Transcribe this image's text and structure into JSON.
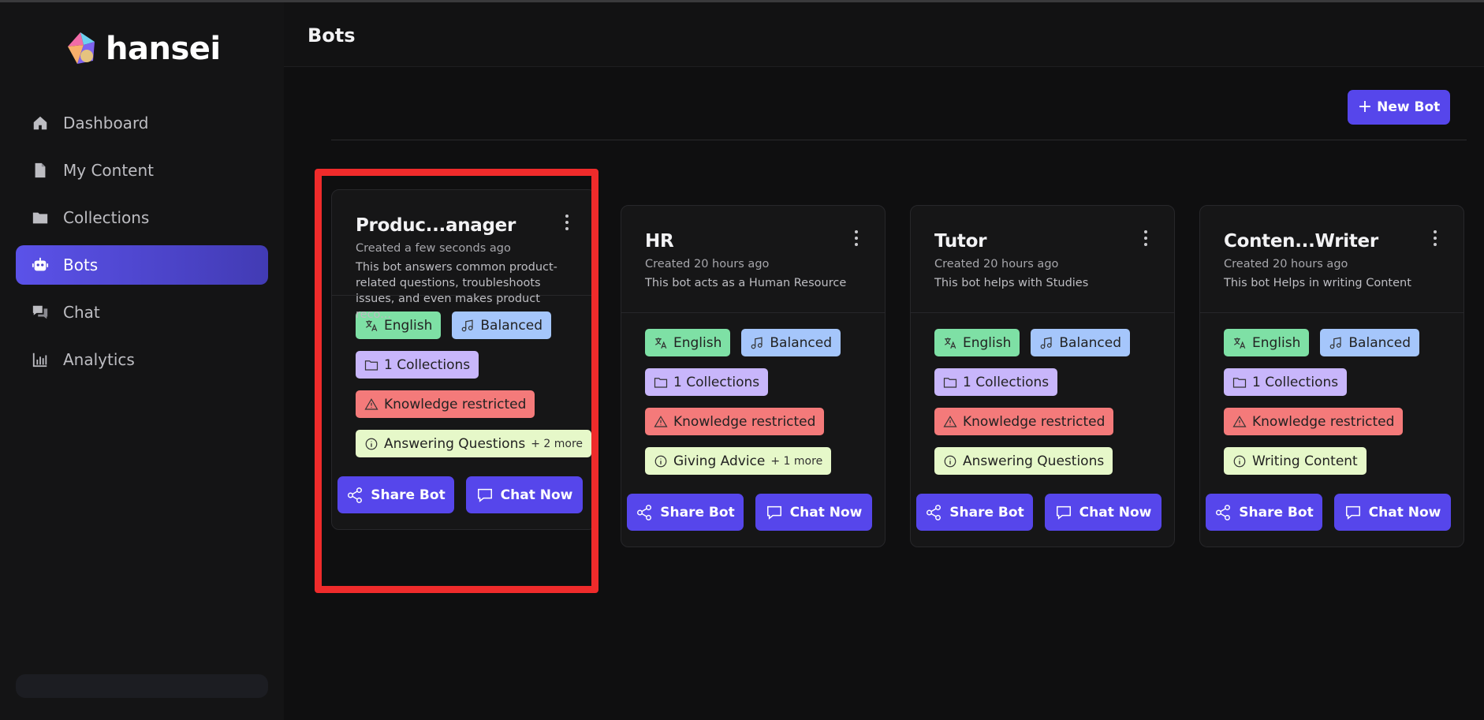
{
  "app": {
    "name": "hansei"
  },
  "sidebar": {
    "items": [
      {
        "label": "Dashboard",
        "icon": "home-icon"
      },
      {
        "label": "My Content",
        "icon": "file-icon"
      },
      {
        "label": "Collections",
        "icon": "folder-icon"
      },
      {
        "label": "Bots",
        "icon": "robot-icon",
        "active": true
      },
      {
        "label": "Chat",
        "icon": "chat-icon"
      },
      {
        "label": "Analytics",
        "icon": "bar-chart-icon"
      }
    ]
  },
  "header": {
    "title": "Bots"
  },
  "toolbar": {
    "new_bot_label": "New Bot"
  },
  "bots": [
    {
      "name": "Produc...anager",
      "created": "Created a few seconds ago",
      "description": "This bot answers common product-related questions, troubleshoots issues, and even makes product reco...",
      "language": "English",
      "tone": "Balanced",
      "collections": "1 Collections",
      "knowledge": "Knowledge restricted",
      "purpose": "Answering Questions",
      "purpose_more": "+ 2 more",
      "share_label": "Share Bot",
      "chat_label": "Chat Now"
    },
    {
      "name": "HR",
      "created": "Created 20 hours ago",
      "description": "This bot acts as a Human Resource",
      "language": "English",
      "tone": "Balanced",
      "collections": "1 Collections",
      "knowledge": "Knowledge restricted",
      "purpose": "Giving Advice",
      "purpose_more": "+ 1 more",
      "share_label": "Share Bot",
      "chat_label": "Chat Now"
    },
    {
      "name": "Tutor",
      "created": "Created 20 hours ago",
      "description": "This bot helps with Studies",
      "language": "English",
      "tone": "Balanced",
      "collections": "1 Collections",
      "knowledge": "Knowledge restricted",
      "purpose": "Answering Questions",
      "purpose_more": "",
      "share_label": "Share Bot",
      "chat_label": "Chat Now"
    },
    {
      "name": "Conten...Writer",
      "created": "Created 20 hours ago",
      "description": "This bot Helps in writing Content",
      "language": "English",
      "tone": "Balanced",
      "collections": "1 Collections",
      "knowledge": "Knowledge restricted",
      "purpose": "Writing Content",
      "purpose_more": "",
      "share_label": "Share Bot",
      "chat_label": "Chat Now"
    }
  ],
  "colors": {
    "accent": "#5646eb",
    "language_tag": "#7ee0a5",
    "tone_tag": "#a5c6fb",
    "collections_tag": "#c8b6fb",
    "knowledge_tag": "#f47a7a",
    "purpose_tag": "#e6f8c9",
    "highlight": "#ef2b2b"
  }
}
